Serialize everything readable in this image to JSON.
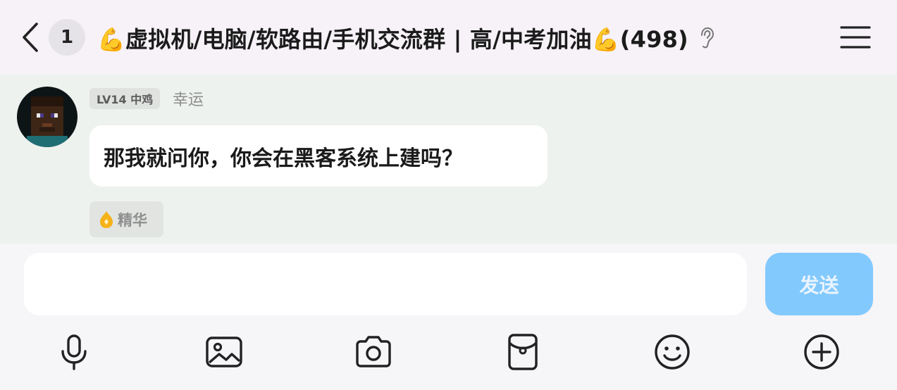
{
  "header": {
    "unread_count": "1",
    "title": "💪虚拟机/电脑/软路由/手机交流群 | 高/中考加油💪(498)"
  },
  "message": {
    "level_badge": "LV14 中鸡",
    "sender_name": "幸运",
    "text": "那我就问你，你会在黑客系统上建吗？",
    "essence_label": "精华"
  },
  "composer": {
    "input_value": "",
    "send_label": "发送"
  },
  "toolbar": {
    "items": [
      "microphone-icon",
      "image-icon",
      "camera-icon",
      "red-packet-icon",
      "emoji-icon",
      "plus-icon"
    ]
  },
  "colors": {
    "send_button": "#82c9fe",
    "message_area_bg": "#eef2ee",
    "essence_flame": "#f6b21b"
  }
}
